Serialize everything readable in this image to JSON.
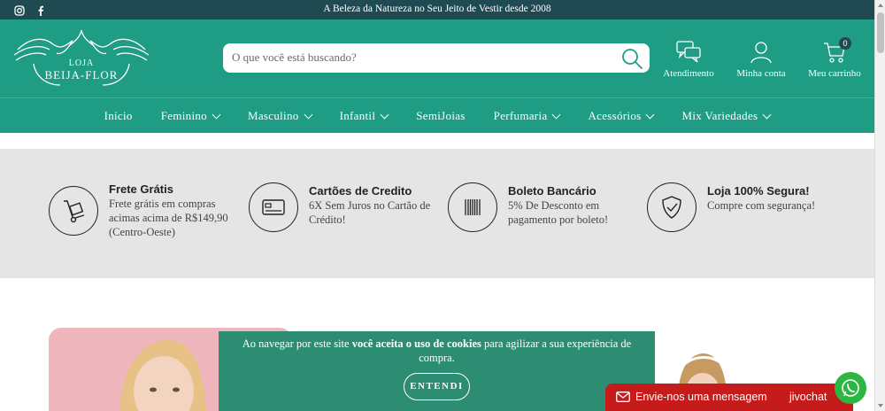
{
  "topbar": {
    "promo": "A Beleza da Natureza no Seu Jeito de Vestir desde 2008",
    "social": [
      "instagram-icon",
      "facebook-icon"
    ]
  },
  "logo": {
    "line1": "LOJA",
    "line2": "BEIJA-FLOR"
  },
  "search": {
    "placeholder": "O que você está buscando?"
  },
  "header_links": {
    "support": "Atendimento",
    "account": "Minha conta",
    "cart": "Meu carrinho",
    "cart_count": "0"
  },
  "nav": [
    {
      "label": "Início",
      "dropdown": false
    },
    {
      "label": "Feminino",
      "dropdown": true
    },
    {
      "label": "Masculino",
      "dropdown": true
    },
    {
      "label": "Infantil",
      "dropdown": true
    },
    {
      "label": "SemiJoias",
      "dropdown": false
    },
    {
      "label": "Perfumaria",
      "dropdown": true
    },
    {
      "label": "Acessórios",
      "dropdown": true
    },
    {
      "label": "Mix Variedades",
      "dropdown": true
    }
  ],
  "benefits": [
    {
      "title": "Frete Grátis",
      "desc": "Frete grátis em compras acimas acima de R$149,90 (Centro-Oeste)",
      "icon": "hand-truck-icon"
    },
    {
      "title": "Cartões de Credito",
      "desc": "6X Sem Juros no Cartão de Crédito!",
      "icon": "credit-card-icon"
    },
    {
      "title": "Boleto Bancário",
      "desc": "5% De Desconto em pagamento por boleto!",
      "icon": "barcode-icon"
    },
    {
      "title": "Loja 100% Segura!",
      "desc": "Compre com segurança!",
      "icon": "shield-check-icon"
    }
  ],
  "cookie": {
    "text_before": "Ao navegar por este site ",
    "text_bold": "você aceita o uso de cookies",
    "text_after": " para agilizar a sua experiência de compra.",
    "button": "ENTENDI"
  },
  "chat": {
    "message": "Envie-nos uma mensagem",
    "brand": "jivochat"
  },
  "colors": {
    "primary": "#1f9c84",
    "topbar": "#1f4a52",
    "benefits_bg": "#e5e5e5",
    "cookie": "#2d8d73",
    "chat": "#c51b1b",
    "whatsapp": "#2cb742"
  }
}
